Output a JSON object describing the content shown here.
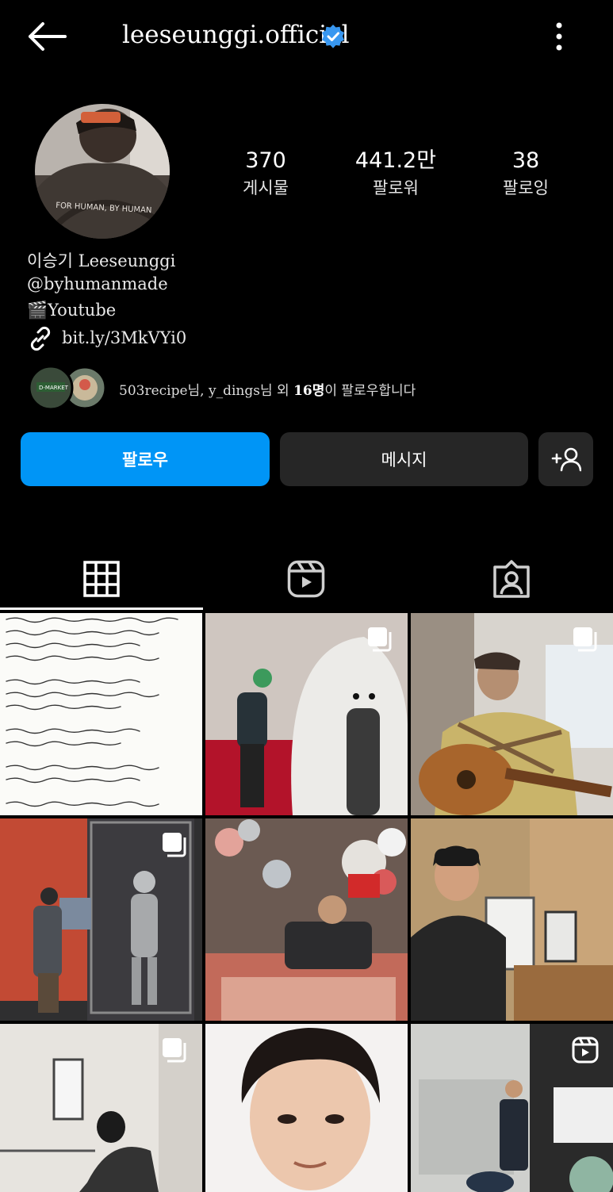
{
  "header": {
    "username": "leeseunggi.official",
    "back_icon": "back-arrow-icon",
    "verified_icon": "verified-badge-icon",
    "more_icon": "more-vertical-icon"
  },
  "profile": {
    "avatar_text": "FOR HUMAN, BY HUMAN",
    "stats": [
      {
        "value": "370",
        "label": "게시물"
      },
      {
        "value": "441.2만",
        "label": "팔로워"
      },
      {
        "value": "38",
        "label": "팔로잉"
      }
    ],
    "name": "이승기 Leeseunggi",
    "mention": "@byhumanmade",
    "youtube": "🎬Youtube",
    "link": "bit.ly/3MkVYi0"
  },
  "mutual": {
    "prefix": "503recipe님, y_dings님 외 ",
    "count": "16명",
    "suffix": "이 팔로우합니다"
  },
  "actions": {
    "follow": "팔로우",
    "message": "메시지",
    "add_icon": "add-person-icon"
  },
  "tabs": [
    {
      "icon": "grid-icon",
      "active": true
    },
    {
      "icon": "reels-icon",
      "active": false
    },
    {
      "icon": "tagged-icon",
      "active": false
    }
  ],
  "colors": {
    "accent": "#0095f6",
    "verified": "#3897f0",
    "button_dark": "#262626"
  }
}
